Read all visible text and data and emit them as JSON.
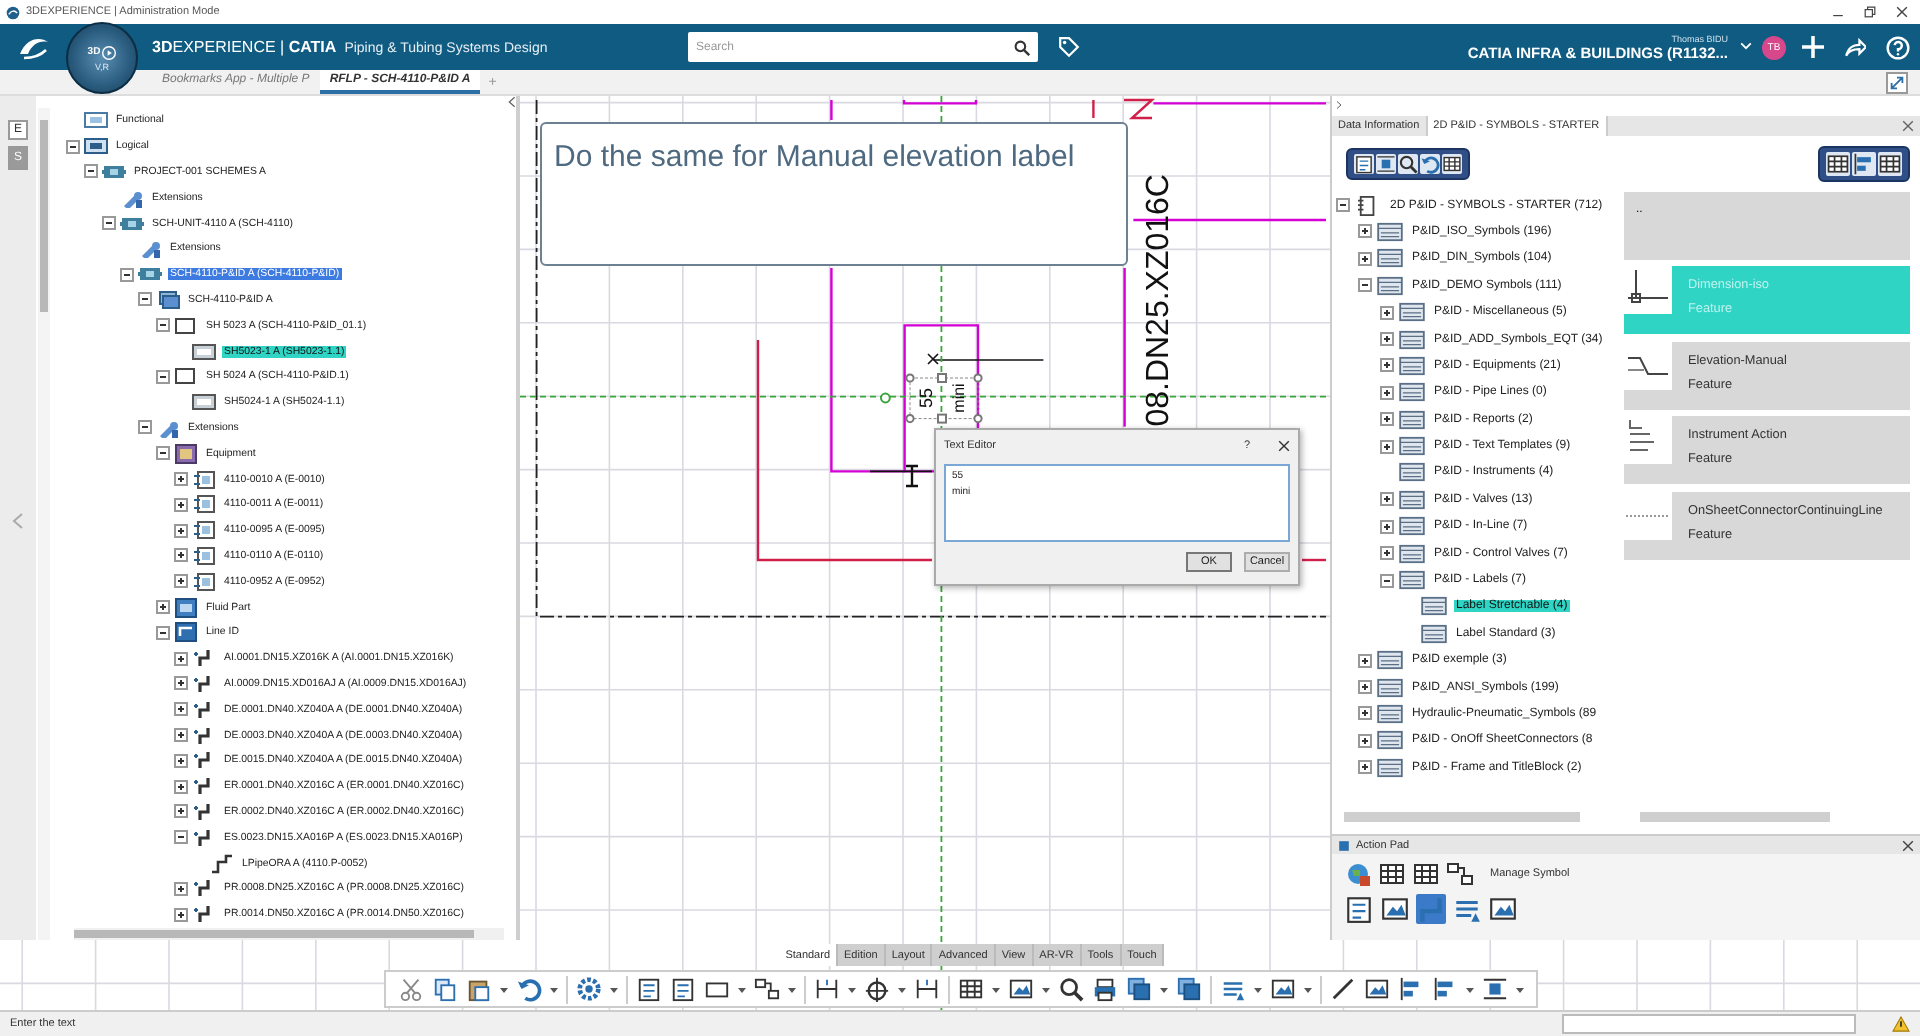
{
  "title_bar": {
    "title": "3DEXPERIENCE | Administration Mode"
  },
  "top_bar": {
    "compass": {
      "top": "3D",
      "bottom": "V,R"
    },
    "brand": "**3D**EXPERIENCE | **CATIA**",
    "role": "Piping & Tubing Systems Design",
    "search": {
      "placeholder": "Search"
    },
    "user": "Thomas BIDU",
    "tenant": "CATIA INFRA & BUILDINGS (R1132...",
    "avatar": "TB"
  },
  "document_tabs": [
    {
      "label": "Bookmarks App - Multiple P",
      "selected": false
    },
    {
      "label": "RFLP - SCH-4110-P&ID A",
      "selected": true
    }
  ],
  "add_tab": "+",
  "left_panel": {
    "strip_buttons": [
      {
        "label": "E",
        "selected": false
      },
      {
        "label": "S",
        "selected": true
      }
    ],
    "tree": [
      {
        "label": "Functional",
        "kind": "functional",
        "selected": false,
        "highlighted": false
      },
      {
        "label": "Logical",
        "kind": "logical",
        "expanded": true,
        "selected": false,
        "highlighted": false,
        "children": [
          {
            "label": "PROJECT-001 SCHEMES A",
            "kind": "product",
            "expanded": true,
            "selected": false,
            "highlighted": false,
            "children": [
              {
                "label": "Extensions",
                "kind": "extension",
                "selected": false,
                "highlighted": false
              },
              {
                "label": "SCH-UNIT-4110 A (SCH-4110)",
                "kind": "product",
                "expanded": true,
                "selected": false,
                "highlighted": false,
                "children": [
                  {
                    "label": "Extensions",
                    "kind": "extension",
                    "selected": false,
                    "highlighted": false
                  },
                  {
                    "label": "SCH-4110-P&ID A (SCH-4110-P&ID)",
                    "kind": "product",
                    "expanded": true,
                    "selected": true,
                    "highlighted": false,
                    "children": [
                      {
                        "label": "SCH-4110-P&ID A",
                        "kind": "sheets",
                        "expanded": true,
                        "selected": false,
                        "highlighted": false,
                        "children": [
                          {
                            "label": "SH 5023 A (SCH-4110-P&ID_01.1)",
                            "kind": "sheet",
                            "expanded": true,
                            "selected": false,
                            "highlighted": false,
                            "children": [
                              {
                                "label": "SH5023-1 A (SH5023-1.1)",
                                "kind": "view",
                                "selected": false,
                                "highlighted": true
                              }
                            ]
                          },
                          {
                            "label": "SH 5024 A (SCH-4110-P&ID.1)",
                            "kind": "sheet",
                            "expanded": true,
                            "selected": false,
                            "highlighted": false,
                            "children": [
                              {
                                "label": "SH5024-1 A (SH5024-1.1)",
                                "kind": "view",
                                "selected": false,
                                "highlighted": false
                              }
                            ]
                          }
                        ]
                      },
                      {
                        "label": "Extensions",
                        "kind": "extension",
                        "expanded": true,
                        "selected": false,
                        "highlighted": false,
                        "children": [
                          {
                            "label": "Equipment",
                            "kind": "equipment-group",
                            "expanded": true,
                            "selected": false,
                            "highlighted": false,
                            "children": [
                              {
                                "label": "4110-0010 A (E-0010)",
                                "kind": "equipment",
                                "expanded": false,
                                "selected": false,
                                "highlighted": false
                              },
                              {
                                "label": "4110-0011 A (E-0011)",
                                "kind": "equipment",
                                "expanded": false,
                                "selected": false,
                                "highlighted": false
                              },
                              {
                                "label": "4110-0095 A (E-0095)",
                                "kind": "equipment",
                                "expanded": false,
                                "selected": false,
                                "highlighted": false
                              },
                              {
                                "label": "4110-0110 A (E-0110)",
                                "kind": "equipment",
                                "expanded": false,
                                "selected": false,
                                "highlighted": false
                              },
                              {
                                "label": "4110-0952 A (E-0952)",
                                "kind": "equipment",
                                "expanded": false,
                                "selected": false,
                                "highlighted": false
                              }
                            ]
                          },
                          {
                            "label": "Fluid Part",
                            "kind": "fluid",
                            "expanded": false,
                            "selected": false,
                            "highlighted": false
                          },
                          {
                            "label": "Line ID",
                            "kind": "line-group",
                            "expanded": true,
                            "selected": false,
                            "highlighted": false,
                            "children": [
                              {
                                "label": "AI.0001.DN15.XZ016K A (AI.0001.DN15.XZ016K)",
                                "kind": "line",
                                "expanded": false,
                                "selected": false,
                                "highlighted": false
                              },
                              {
                                "label": "AI.0009.DN15.XD016AJ A (AI.0009.DN15.XD016AJ)",
                                "kind": "line",
                                "expanded": false,
                                "selected": false,
                                "highlighted": false
                              },
                              {
                                "label": "DE.0001.DN40.XZ040A A (DE.0001.DN40.XZ040A)",
                                "kind": "line",
                                "expanded": false,
                                "selected": false,
                                "highlighted": false
                              },
                              {
                                "label": "DE.0003.DN40.XZ040A A (DE.0003.DN40.XZ040A)",
                                "kind": "line",
                                "expanded": false,
                                "selected": false,
                                "highlighted": false
                              },
                              {
                                "label": "DE.0015.DN40.XZ040A A (DE.0015.DN40.XZ040A)",
                                "kind": "line",
                                "expanded": false,
                                "selected": false,
                                "highlighted": false
                              },
                              {
                                "label": "ER.0001.DN40.XZ016C A (ER.0001.DN40.XZ016C)",
                                "kind": "line",
                                "expanded": false,
                                "selected": false,
                                "highlighted": false
                              },
                              {
                                "label": "ER.0002.DN40.XZ016C A (ER.0002.DN40.XZ016C)",
                                "kind": "line",
                                "expanded": false,
                                "selected": false,
                                "highlighted": false
                              },
                              {
                                "label": "ES.0023.DN15.XA016P A (ES.0023.DN15.XA016P)",
                                "kind": "line",
                                "expanded": true,
                                "selected": false,
                                "highlighted": false,
                                "children": [
                                  {
                                    "label": "LPipeORA A (4110.P-0052)",
                                    "kind": "pipe",
                                    "selected": false,
                                    "highlighted": false
                                  }
                                ]
                              },
                              {
                                "label": "PR.0008.DN25.XZ016C A (PR.0008.DN25.XZ016C)",
                                "kind": "line",
                                "expanded": false,
                                "selected": false,
                                "highlighted": false
                              },
                              {
                                "label": "PR.0014.DN50.XZ016C A (PR.0014.DN50.XZ016C)",
                                "kind": "line",
                                "expanded": false,
                                "selected": false,
                                "highlighted": false
                              }
                            ]
                          }
                        ]
                      }
                    ]
                  }
                ]
              }
            ]
          }
        ]
      }
    ]
  },
  "canvas": {
    "callout": "Do the same for Manual elevation label",
    "line_label": "08.DN25.XZ016C",
    "label_lines": [
      "55",
      "mini"
    ]
  },
  "text_editor": {
    "title": "Text Editor",
    "help": "?",
    "value": "55\nmini",
    "buttons": [
      "OK",
      "Cancel"
    ]
  },
  "right_panel": {
    "tabs": [
      {
        "label": "Data Information",
        "selected": false
      },
      {
        "label": "2D P&ID - SYMBOLS - STARTER",
        "selected": true
      }
    ],
    "tree": [
      {
        "label": "2D P&ID - SYMBOLS - STARTER (712)",
        "kind": "catalog",
        "expanded": true,
        "selected": false,
        "children": [
          {
            "label": "P&ID_ISO_Symbols (196)",
            "kind": "folder",
            "expanded": false,
            "selected": false
          },
          {
            "label": "P&ID_DIN_Symbols (104)",
            "kind": "folder",
            "expanded": false,
            "selected": false
          },
          {
            "label": "P&ID_DEMO Symbols (111)",
            "kind": "folder",
            "expanded": true,
            "selected": false,
            "children": [
              {
                "label": "P&ID - Miscellaneous (5)",
                "kind": "folder",
                "expanded": false,
                "selected": false
              },
              {
                "label": "P&ID_ADD_Symbols_EQT (34)",
                "kind": "folder",
                "expanded": false,
                "selected": false
              },
              {
                "label": "P&ID - Equipments (21)",
                "kind": "folder",
                "expanded": false,
                "selected": false
              },
              {
                "label": "P&ID - Pipe Lines (0)",
                "kind": "folder",
                "expanded": false,
                "selected": false
              },
              {
                "label": "P&ID - Reports (2)",
                "kind": "folder",
                "expanded": false,
                "selected": false
              },
              {
                "label": "P&ID - Text Templates (9)",
                "kind": "folder",
                "expanded": false,
                "selected": false
              },
              {
                "label": "P&ID - Instruments (4)",
                "kind": "folder",
                "selected": false
              },
              {
                "label": "P&ID - Valves (13)",
                "kind": "folder",
                "expanded": false,
                "selected": false
              },
              {
                "label": "P&ID - In-Line (7)",
                "kind": "folder",
                "expanded": false,
                "selected": false
              },
              {
                "label": "P&ID - Control Valves (7)",
                "kind": "folder",
                "expanded": false,
                "selected": false
              },
              {
                "label": "P&ID - Labels (7)",
                "kind": "folder",
                "expanded": true,
                "selected": false,
                "children": [
                  {
                    "label": "Label Stretchable (4)",
                    "kind": "folder",
                    "selected": true
                  },
                  {
                    "label": "Label Standard (3)",
                    "kind": "folder",
                    "selected": false
                  }
                ]
              }
            ]
          },
          {
            "label": "P&ID exemple (3)",
            "kind": "folder",
            "expanded": false,
            "selected": false
          },
          {
            "label": "P&ID_ANSI_Symbols (199)",
            "kind": "folder",
            "expanded": false,
            "selected": false
          },
          {
            "label": "Hydraulic-Pneumatic_Symbols (89",
            "kind": "folder",
            "expanded": false,
            "selected": false
          },
          {
            "label": "P&ID - OnOff SheetConnectors (8",
            "kind": "folder",
            "expanded": false,
            "selected": false
          },
          {
            "label": "P&ID - Frame and TitleBlock (2)",
            "kind": "folder",
            "expanded": false,
            "selected": false
          }
        ]
      }
    ],
    "symbols": [
      {
        "title": "..",
        "kind": "parent",
        "selected": false
      },
      {
        "title": "Dimension-iso",
        "subtitle": "Feature",
        "kind": "dimension",
        "selected": true
      },
      {
        "title": "Elevation-Manual",
        "subtitle": "Feature",
        "kind": "elevation",
        "selected": false
      },
      {
        "title": "Instrument Action",
        "subtitle": "Feature",
        "kind": "instrument",
        "selected": false
      },
      {
        "title": "OnSheetConnectorContinuingLine",
        "subtitle": "Feature",
        "kind": "connector",
        "selected": false
      }
    ]
  },
  "action_pad": {
    "title": "Action Pad",
    "label": "Manage Symbol"
  },
  "command_bar": {
    "tabs": [
      {
        "label": "Standard",
        "selected": true
      },
      {
        "label": "Edition",
        "selected": false
      },
      {
        "label": "Layout",
        "selected": false
      },
      {
        "label": "Advanced",
        "selected": false
      },
      {
        "label": "View",
        "selected": false
      },
      {
        "label": "AR-VR",
        "selected": false
      },
      {
        "label": "Tools",
        "selected": false
      },
      {
        "label": "Touch",
        "selected": false
      }
    ]
  },
  "status_bar": {
    "message": "Enter the text"
  }
}
